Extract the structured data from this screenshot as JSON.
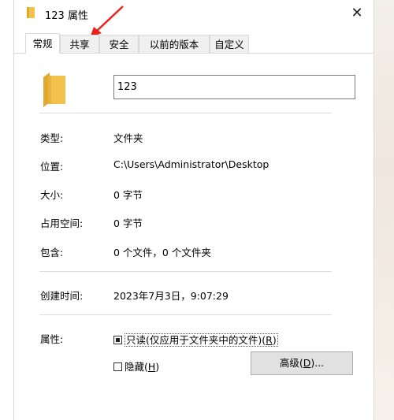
{
  "window": {
    "title": "123 属性",
    "close_glyph": "✕"
  },
  "tabs": [
    {
      "label": "常规",
      "active": true
    },
    {
      "label": "共享",
      "active": false
    },
    {
      "label": "安全",
      "active": false
    },
    {
      "label": "以前的版本",
      "active": false
    },
    {
      "label": "自定义",
      "active": false
    }
  ],
  "general": {
    "name_value": "123",
    "rows": [
      {
        "label": "类型:",
        "value": "文件夹"
      },
      {
        "label": "位置:",
        "value": "C:\\Users\\Administrator\\Desktop"
      },
      {
        "label": "大小:",
        "value": "0 字节"
      },
      {
        "label": "占用空间:",
        "value": "0 字节"
      },
      {
        "label": "包含:",
        "value": "0 个文件，0 个文件夹"
      },
      {
        "label": "创建时间:",
        "value": "2023年7月3日，9:07:29"
      }
    ],
    "attributes": {
      "label": "属性:",
      "readonly_text": "只读(仅应用于文件夹中的文件)(",
      "readonly_key": "R",
      "readonly_close": ")",
      "hidden_text": "隐藏(",
      "hidden_key": "H",
      "hidden_close": ")",
      "advanced_text": "高级(",
      "advanced_key": "D",
      "advanced_close": ")..."
    }
  },
  "colors": {
    "folder": "#f2c14e",
    "annotation": "#e8231b"
  },
  "icons": {
    "title": "folder-icon",
    "large": "folder-icon",
    "annotation": "red-arrow"
  }
}
